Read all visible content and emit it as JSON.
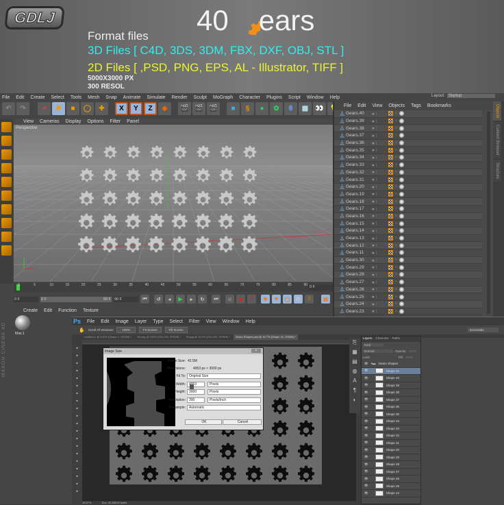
{
  "header": {
    "logo": "GDLJ",
    "title_num": "40",
    "title_word": "ears",
    "format": "Format files",
    "files3d": "3D Files [ C4D, 3DS, 3DM, FBX, DXF, OBJ, STL ]",
    "files2d": "2D Files [    ,PSD, PNG, EPS, AL - Illustrator, TIFF ]",
    "size": "5000X3000 PX",
    "resol": "300 RESOL",
    "colors": {
      "cyan": "#2ef0ee",
      "yellow": "#e8f531",
      "orange": "#f0901a"
    }
  },
  "c4d": {
    "menu": [
      "File",
      "Edit",
      "Create",
      "Select",
      "Tools",
      "Mesh",
      "Snap",
      "Animate",
      "Simulate",
      "Render",
      "Sculpt",
      "MoGraph",
      "Character",
      "Plugins",
      "Script",
      "Window",
      "Help"
    ],
    "layout_label": "Layout:",
    "layout_value": "Startup",
    "axis": [
      "X",
      "Y",
      "Z"
    ],
    "viewport_menu": [
      "View",
      "Cameras",
      "Display",
      "Options",
      "Filter",
      "Panel"
    ],
    "viewport_label": "Perspective",
    "obj_menu": [
      "File",
      "Edit",
      "View",
      "Objects",
      "Tags",
      "Bookmarks"
    ],
    "side_tabs": [
      "Objects",
      "Content Browser",
      "Structure"
    ],
    "objects": [
      "Gears.40",
      "Gears.39",
      "Gears.38",
      "Gears.37",
      "Gears.36",
      "Gears.35",
      "Gears.34",
      "Gears.33",
      "Gears.32",
      "Gears.31",
      "Gears.20",
      "Gears.19",
      "Gears.18",
      "Gears.17",
      "Gears.16",
      "Gears.15",
      "Gears.14",
      "Gears.13",
      "Gears.12",
      "Gears.11",
      "Gears.30",
      "Gears.29",
      "Gears.28",
      "Gears.27",
      "Gears.26",
      "Gears.25",
      "Gears.24",
      "Gears.23"
    ],
    "timeline_ticks": [
      "0",
      "5",
      "10",
      "15",
      "20",
      "25",
      "30",
      "35",
      "40",
      "45",
      "50",
      "55",
      "60",
      "65",
      "70",
      "75",
      "80",
      "85",
      "90"
    ],
    "current_frame": "0 F",
    "start_field": "0 F",
    "range_start": "0 F",
    "range_end": "90 F",
    "end_field": "90 F",
    "mat_menu": [
      "Create",
      "Edit",
      "Function",
      "Texture"
    ],
    "material": "Mat.1",
    "brand": "MAXON CINEMA 4D"
  },
  "ps": {
    "logo": "Ps",
    "menu": [
      "File",
      "Edit",
      "Image",
      "Layer",
      "Type",
      "Select",
      "Filter",
      "View",
      "Window",
      "Help"
    ],
    "options": {
      "scroll_all": "Scroll All Windows",
      "b1": "100%",
      "b2": "Fit Screen",
      "b3": "Fill Screen"
    },
    "workspace": "Essentials",
    "tabs": [
      "Untitled-1 @ 100% (Shape 1, RGB/8) *",
      "05.png @ 100% (230,230, RGB/8) *",
      "06.jpg @ 33.3% (230,230, RGB/8) *",
      "Gears Shapes.psd @ 16.7% (Shape 41, RGB/8) *"
    ],
    "status": {
      "zoom": "16.67%",
      "doc": "Doc: 42.5M/15 bytes"
    },
    "dialog": {
      "title": "Image Size",
      "image_size_label": "Image Size:",
      "image_size": "42.5M",
      "dimensions_label": "Dimensions:",
      "dimensions": "4953 px  ×  3000 px",
      "fit_label": "Fit To:",
      "fit": "Original Size",
      "width_label": "Width:",
      "width": "4953",
      "width_unit": "Pixels",
      "height_label": "Height:",
      "height": "3000",
      "height_unit": "Pixels",
      "res_label": "Resolution:",
      "res": "300",
      "res_unit": "Pixels/Inch",
      "resample_label": "Resample:",
      "resample": "Automatic",
      "ok": "OK",
      "cancel": "Cancel"
    },
    "layers_panel": {
      "tabs": [
        "Layers",
        "Channels",
        "Paths"
      ],
      "kind": "Kind",
      "blend": "Normal",
      "opacity_label": "Opacity:",
      "opacity": "100%",
      "lock_label": "Lock:",
      "fill_label": "Fill:",
      "fill": "100%",
      "group": "Gears Shapes",
      "layers": [
        "Shape 41",
        "Shape 40",
        "Shape 39",
        "Shape 38",
        "Shape 37",
        "Shape 36",
        "Shape 35",
        "Shape 34",
        "Shape 33",
        "Shape 32",
        "Shape 31",
        "Shape 30",
        "Shape 29",
        "Shape 28",
        "Shape 27",
        "Shape 26",
        "Shape 25",
        "Shape 24"
      ]
    }
  }
}
